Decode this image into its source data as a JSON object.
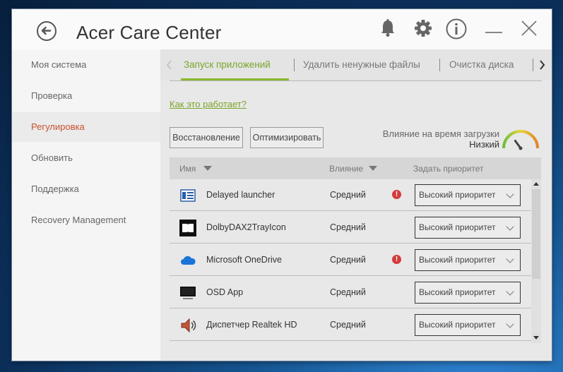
{
  "app": {
    "title": "Acer Care Center"
  },
  "sidebar": {
    "items": [
      {
        "label": "Моя система",
        "active": false
      },
      {
        "label": "Проверка",
        "active": false
      },
      {
        "label": "Регулировка",
        "active": true
      },
      {
        "label": "Обновить",
        "active": false
      },
      {
        "label": "Поддержка",
        "active": false
      },
      {
        "label": "Recovery Management",
        "active": false
      }
    ]
  },
  "tabs": [
    {
      "label": "Запуск приложений",
      "active": true
    },
    {
      "label": "Удалить ненужные файлы",
      "active": false
    },
    {
      "label": "Очистка диска",
      "active": false
    }
  ],
  "help_link": "Как это работает?",
  "buttons": {
    "restore": "Восстановление",
    "optimize": "Оптимизировать"
  },
  "boot_impact": {
    "label": "Влияние на время загрузки",
    "value": "Низкий",
    "level": 0.3
  },
  "table": {
    "headers": {
      "name": "Имя",
      "impact": "Влияние",
      "priority": "Задать приоритет"
    },
    "rows": [
      {
        "name": "Delayed launcher",
        "impact": "Средний",
        "warning": true,
        "priority": "Высокий приоритет",
        "icon": "delayed-launcher-icon"
      },
      {
        "name": "DolbyDAX2TrayIcon",
        "impact": "Средний",
        "warning": false,
        "priority": "Высокий приоритет",
        "icon": "dolby-icon"
      },
      {
        "name": "Microsoft OneDrive",
        "impact": "Средний",
        "warning": true,
        "priority": "Высокий приоритет",
        "icon": "onedrive-icon"
      },
      {
        "name": "OSD App",
        "impact": "Средний",
        "warning": false,
        "priority": "Высокий приоритет",
        "icon": "monitor-icon"
      },
      {
        "name": "Диспетчер Realtek HD",
        "impact": "Средний",
        "warning": false,
        "priority": "Высокий приоритет",
        "icon": "speaker-icon"
      }
    ]
  },
  "colors": {
    "accent_green": "#8ab92d",
    "active_orange": "#c8502c",
    "warning_red": "#d43b3b"
  }
}
